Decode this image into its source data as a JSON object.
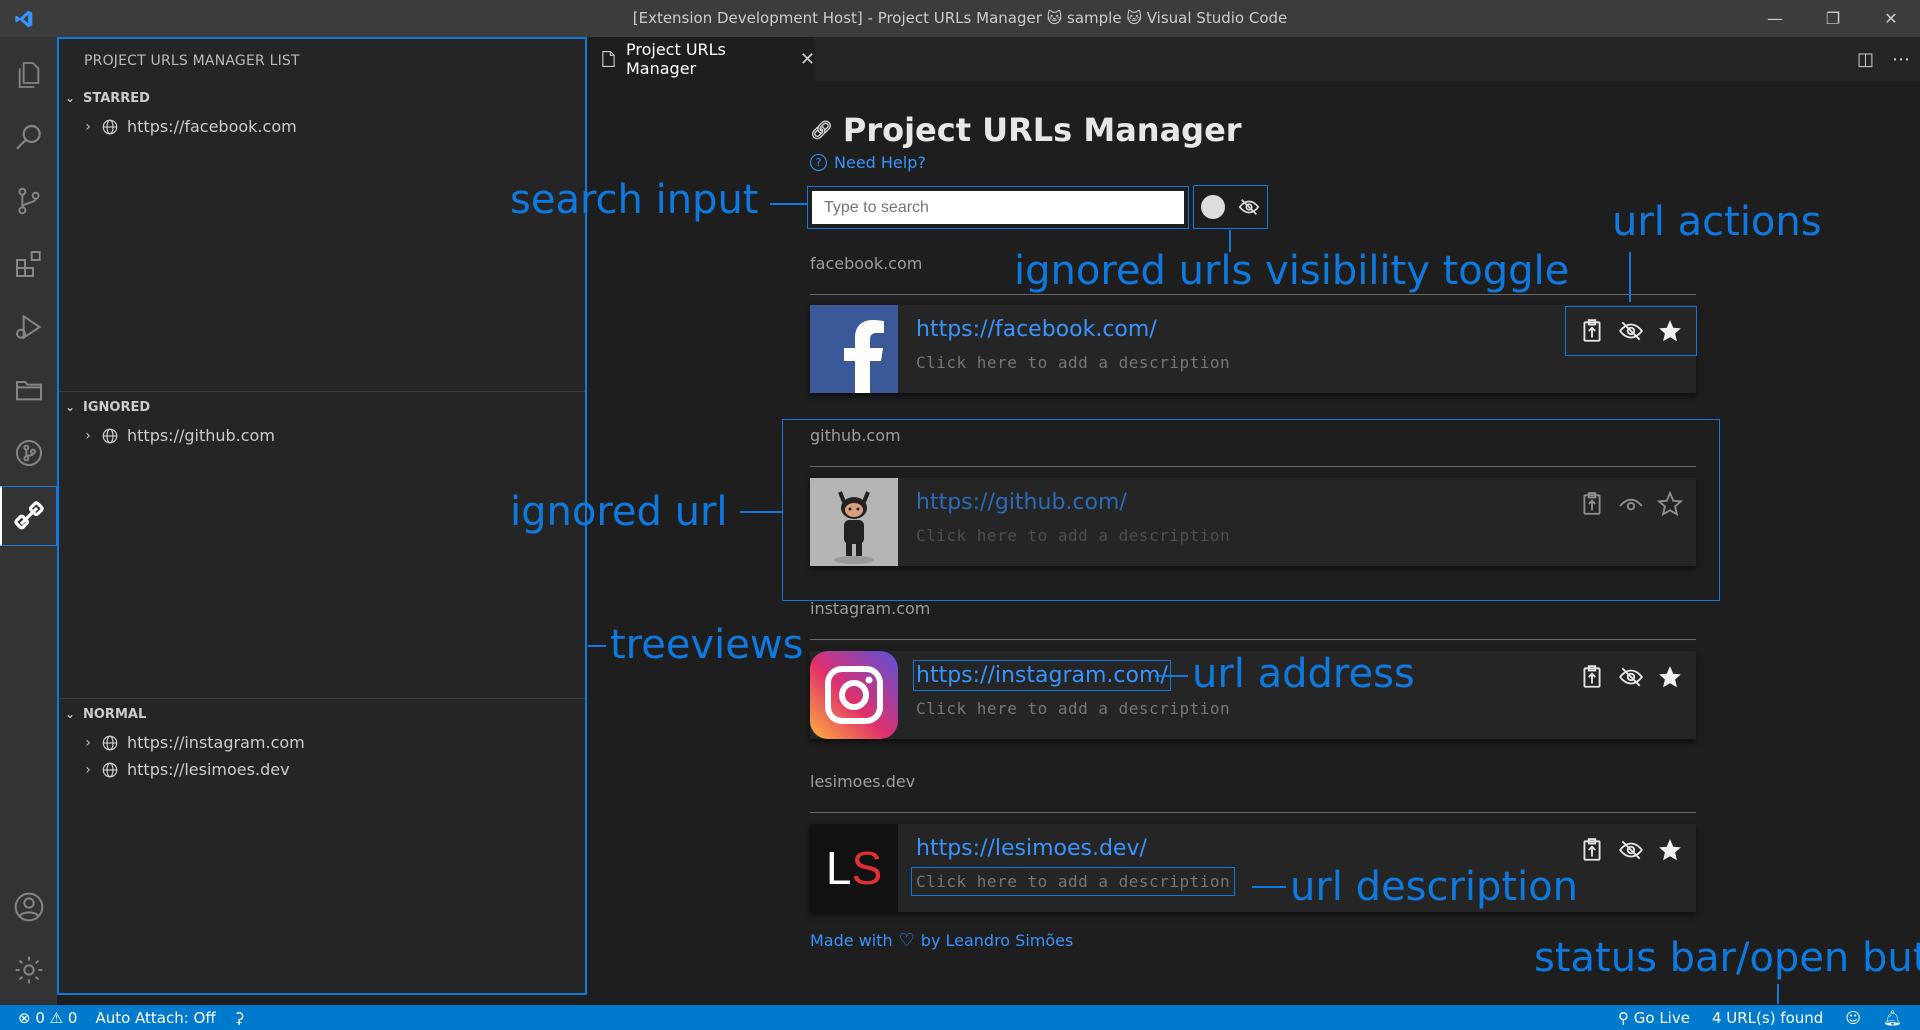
{
  "window": {
    "title": "[Extension Development Host] - Project URLs Manager 🐱 sample 🐱 Visual Studio Code",
    "logo": "VS"
  },
  "sidebar": {
    "title": "PROJECT URLS MANAGER LIST",
    "sections": [
      {
        "label": "STARRED",
        "items": [
          "https://facebook.com"
        ]
      },
      {
        "label": "IGNORED",
        "items": [
          "https://github.com"
        ]
      },
      {
        "label": "NORMAL",
        "items": [
          "https://instagram.com",
          "https://lesimoes.dev"
        ]
      }
    ]
  },
  "tab": {
    "label": "Project URLs Manager"
  },
  "app": {
    "title": "Project URLs Manager",
    "help": "Need Help?",
    "search_placeholder": "Type to search",
    "groups": [
      {
        "domain": "facebook.com",
        "url": "https://facebook.com/",
        "description": "Click here to add a description",
        "ignored": false
      },
      {
        "domain": "github.com",
        "url": "https://github.com/",
        "description": "Click here to add a description",
        "ignored": true
      },
      {
        "domain": "instagram.com",
        "url": "https://instagram.com/",
        "description": "Click here to add a description",
        "ignored": false
      },
      {
        "domain": "lesimoes.dev",
        "url": "https://lesimoes.dev/",
        "description": "Click here to add a description",
        "ignored": false
      }
    ],
    "credit_prefix": "Made with",
    "credit_suffix": "by Leandro Simões",
    "lesimoes_logo_l": "L",
    "lesimoes_logo_s": "S"
  },
  "annotations": {
    "search_input": "search input",
    "visibility_toggle": "ignored urls visibility toggle",
    "url_actions": "url actions",
    "ignored_url": "ignored url",
    "treeviews": "treeviews",
    "url_address": "url address",
    "url_description": "url description",
    "status_bar": "status bar/open button"
  },
  "statusbar": {
    "errors": "⊗ 0",
    "warnings": "⚠ 0",
    "auto_attach": "Auto Attach: Off",
    "go_live": "Go Live",
    "url_count": "4 URL(s) found"
  },
  "colors": {
    "accent": "#0e7ae0",
    "link": "#3794ff",
    "statusbar": "#007acc"
  }
}
